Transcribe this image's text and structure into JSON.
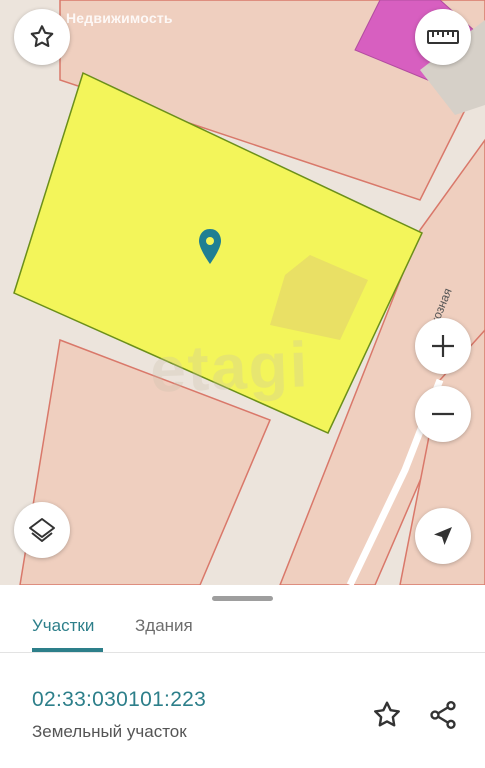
{
  "map": {
    "watermark_top": "Недвижимость",
    "watermark_big": "etagi",
    "street_label": "Колхозная"
  },
  "buttons": {
    "favorite_icon": "star-outline-icon",
    "ruler_icon": "ruler-icon",
    "zoom_in_icon": "plus-icon",
    "zoom_out_icon": "minus-icon",
    "layers_icon": "layers-icon",
    "locate_icon": "navigation-arrow-icon"
  },
  "tabs": [
    {
      "label": "Участки",
      "active": true
    },
    {
      "label": "Здания",
      "active": false
    }
  ],
  "parcel": {
    "cadastral_number": "02:33:030101:223",
    "type": "Земельный участок"
  },
  "colors": {
    "accent": "#2d7f8a",
    "parcel_fill": "#f3f55a",
    "marker": "#1f7f93",
    "pink_building": "#d75fc0"
  }
}
